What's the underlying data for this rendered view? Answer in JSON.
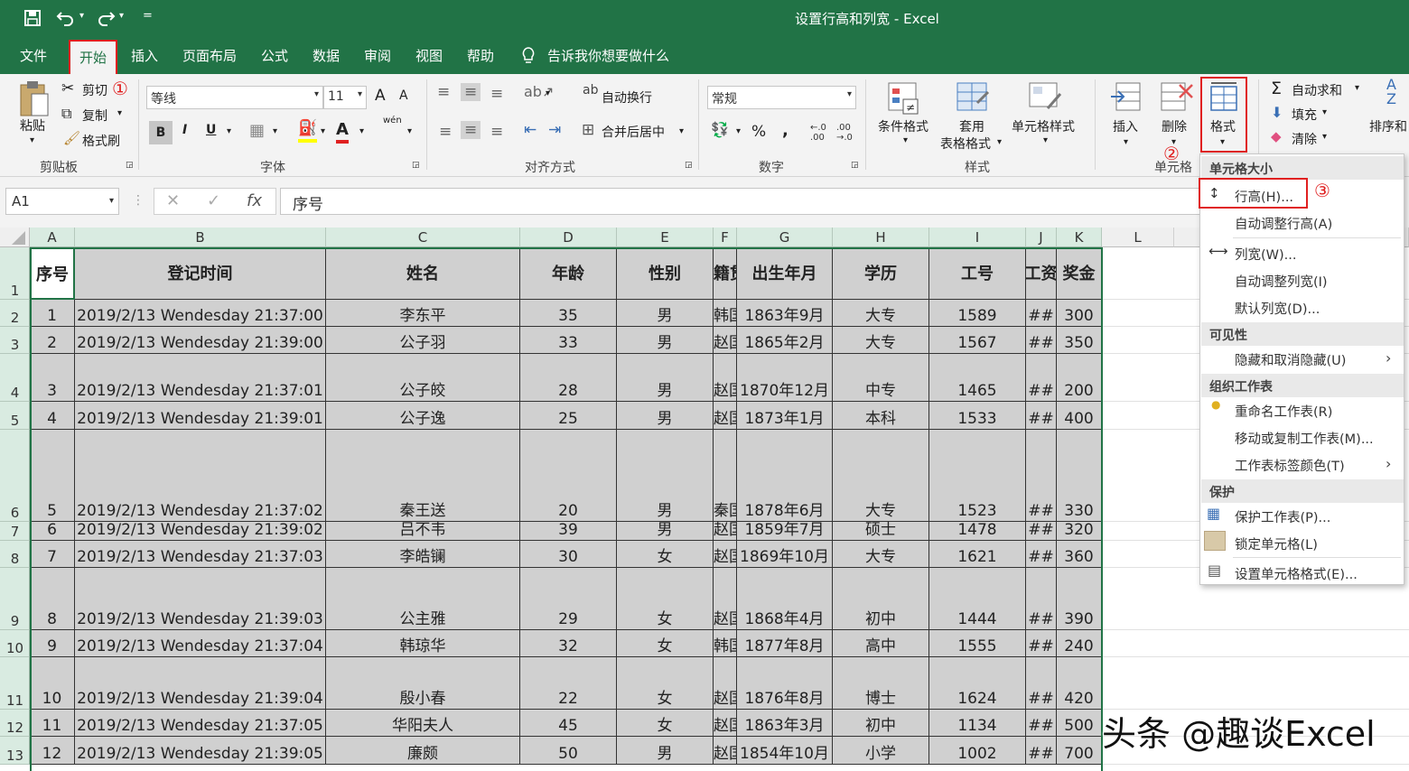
{
  "window": {
    "title": "设置行高和列宽  -  Excel"
  },
  "quick_access": {
    "save_icon": "save-icon",
    "undo_icon": "undo-icon",
    "redo_icon": "redo-icon",
    "customize_glyph": "="
  },
  "tabs": {
    "file": "文件",
    "home": "开始",
    "insert": "插入",
    "page_layout": "页面布局",
    "formulas": "公式",
    "data": "数据",
    "review": "审阅",
    "view": "视图",
    "help": "帮助",
    "tell_me": "告诉我你想要做什么"
  },
  "annotations": {
    "one": "①",
    "two": "②",
    "three": "③"
  },
  "clipboard": {
    "paste": "粘贴",
    "cut": "剪切",
    "copy": "复制",
    "format_painter": "格式刷",
    "label": "剪贴板"
  },
  "font": {
    "name": "等线",
    "size": "11",
    "bold": "B",
    "italic": "I",
    "underline": "U",
    "label": "字体",
    "grow": "A",
    "shrink": "A",
    "wen": "wén"
  },
  "alignment": {
    "wrap_text": "自动换行",
    "merge_center": "合并后居中",
    "label": "对齐方式"
  },
  "number": {
    "format": "常规",
    "percent": "%",
    "comma": ",",
    "label": "数字",
    "inc_decimal": "←.0 .00",
    "dec_decimal": ".00 →.0"
  },
  "styles": {
    "conditional": "条件格式",
    "table_format_1": "套用",
    "table_format_2": "表格格式",
    "cell_styles": "单元格样式",
    "label": "样式"
  },
  "cells": {
    "insert": "插入",
    "delete": "删除",
    "format": "格式",
    "label": "单元格"
  },
  "editing": {
    "autosum": "自动求和",
    "fill": "填充",
    "clear": "清除",
    "sort": "排序和",
    "sigma": "Σ"
  },
  "formula_bar": {
    "name_box": "A1",
    "cancel": "✕",
    "enter": "✓",
    "fx": "fx",
    "content": "序号"
  },
  "columns": [
    "A",
    "B",
    "C",
    "D",
    "E",
    "F",
    "G",
    "H",
    "I",
    "J",
    "K",
    "L"
  ],
  "row_numbers": [
    "1",
    "2",
    "3",
    "4",
    "5",
    "6",
    "7",
    "8",
    "9",
    "10",
    "11",
    "12",
    "13"
  ],
  "table": {
    "headers": [
      "序号",
      "登记时间",
      "姓名",
      "年龄",
      "性别",
      "籍贯",
      "出生年月",
      "学历",
      "工号",
      "工资",
      "奖金"
    ],
    "rows": [
      [
        "1",
        "2019/2/13  Wendesday  21:37:00",
        "李东平",
        "35",
        "男",
        "韩国",
        "1863年9月",
        "大专",
        "1589",
        "##",
        "300"
      ],
      [
        "2",
        "2019/2/13  Wendesday  21:39:00",
        "公子羽",
        "33",
        "男",
        "赵国",
        "1865年2月",
        "大专",
        "1567",
        "##",
        "350"
      ],
      [
        "3",
        "2019/2/13  Wendesday  21:37:01",
        "公子皎",
        "28",
        "男",
        "赵国",
        "1870年12月",
        "中专",
        "1465",
        "##",
        "200"
      ],
      [
        "4",
        "2019/2/13  Wendesday  21:39:01",
        "公子逸",
        "25",
        "男",
        "赵国",
        "1873年1月",
        "本科",
        "1533",
        "##",
        "400"
      ],
      [
        "5",
        "2019/2/13  Wendesday  21:37:02",
        "秦王送",
        "20",
        "男",
        "秦国",
        "1878年6月",
        "大专",
        "1523",
        "##",
        "330"
      ],
      [
        "6",
        "2019/2/13  Wendesday  21:39:02",
        "吕不韦",
        "39",
        "男",
        "赵国",
        "1859年7月",
        "硕士",
        "1478",
        "##",
        "320"
      ],
      [
        "7",
        "2019/2/13  Wendesday  21:37:03",
        "李皓镧",
        "30",
        "女",
        "赵国",
        "1869年10月",
        "大专",
        "1621",
        "##",
        "360"
      ],
      [
        "8",
        "2019/2/13  Wendesday  21:39:03",
        "公主雅",
        "29",
        "女",
        "赵国",
        "1868年4月",
        "初中",
        "1444",
        "##",
        "390"
      ],
      [
        "9",
        "2019/2/13  Wendesday  21:37:04",
        "韩琼华",
        "32",
        "女",
        "韩国",
        "1877年8月",
        "高中",
        "1555",
        "##",
        "240"
      ],
      [
        "10",
        "2019/2/13  Wendesday  21:39:04",
        "殷小春",
        "22",
        "女",
        "赵国",
        "1876年8月",
        "博士",
        "1624",
        "##",
        "420"
      ],
      [
        "11",
        "2019/2/13  Wendesday  21:37:05",
        "华阳夫人",
        "45",
        "女",
        "赵国",
        "1863年3月",
        "初中",
        "1134",
        "##",
        "500"
      ],
      [
        "12",
        "2019/2/13  Wendesday  21:39:05",
        "廉颇",
        "50",
        "男",
        "赵国",
        "1854年10月",
        "小学",
        "1002",
        "##",
        "700"
      ]
    ]
  },
  "format_menu": {
    "section_cell_size": "单元格大小",
    "row_height": "行高(H)...",
    "autofit_row": "自动调整行高(A)",
    "col_width": "列宽(W)...",
    "autofit_col": "自动调整列宽(I)",
    "default_width": "默认列宽(D)...",
    "section_visibility": "可见性",
    "hide_unhide": "隐藏和取消隐藏(U)",
    "section_organize": "组织工作表",
    "rename": "重命名工作表(R)",
    "move_copy": "移动或复制工作表(M)...",
    "tab_color": "工作表标签颜色(T)",
    "section_protect": "保护",
    "protect_sheet": "保护工作表(P)...",
    "lock_cell": "锁定单元格(L)",
    "format_cells": "设置单元格格式(E)...",
    "submenu_arrow": "›"
  },
  "watermark": "头条 @趣谈Excel",
  "colors": {
    "accent": "#217346",
    "annotation": "#e02020",
    "cell_fill": "#d0d0d0"
  }
}
